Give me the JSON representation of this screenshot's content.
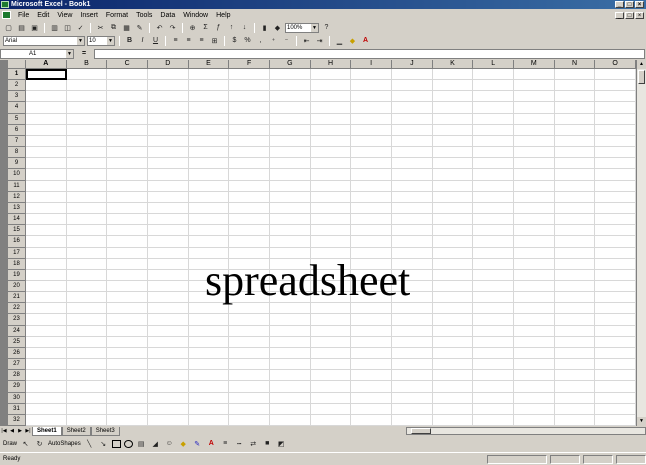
{
  "window": {
    "title": "Microsoft Excel - Book1"
  },
  "menu": [
    "File",
    "Edit",
    "View",
    "Insert",
    "Format",
    "Tools",
    "Data",
    "Window",
    "Help"
  ],
  "toolbar1": {
    "zoom": "100%"
  },
  "toolbar2": {
    "font": "Arial",
    "size": "10",
    "bold": "B",
    "italic": "I",
    "underline": "U"
  },
  "formula_bar": {
    "name_box": "A1",
    "equals": "="
  },
  "grid": {
    "columns": [
      "A",
      "B",
      "C",
      "D",
      "E",
      "F",
      "G",
      "H",
      "I",
      "J",
      "K",
      "L",
      "M",
      "N",
      "O"
    ],
    "rows": [
      "1",
      "2",
      "3",
      "4",
      "5",
      "6",
      "7",
      "8",
      "9",
      "10",
      "11",
      "12",
      "13",
      "14",
      "15",
      "16",
      "17",
      "18",
      "19",
      "20",
      "21",
      "22",
      "23",
      "24",
      "25",
      "26",
      "27",
      "28",
      "29",
      "30",
      "31",
      "32"
    ],
    "active_cell": "A1"
  },
  "sheet_tabs": [
    "Sheet1",
    "Sheet2",
    "Sheet3"
  ],
  "draw_toolbar": {
    "draw": "Draw",
    "autoshapes": "AutoShapes"
  },
  "status": {
    "text": "Ready"
  },
  "overlay": {
    "text": "spreadsheet"
  }
}
